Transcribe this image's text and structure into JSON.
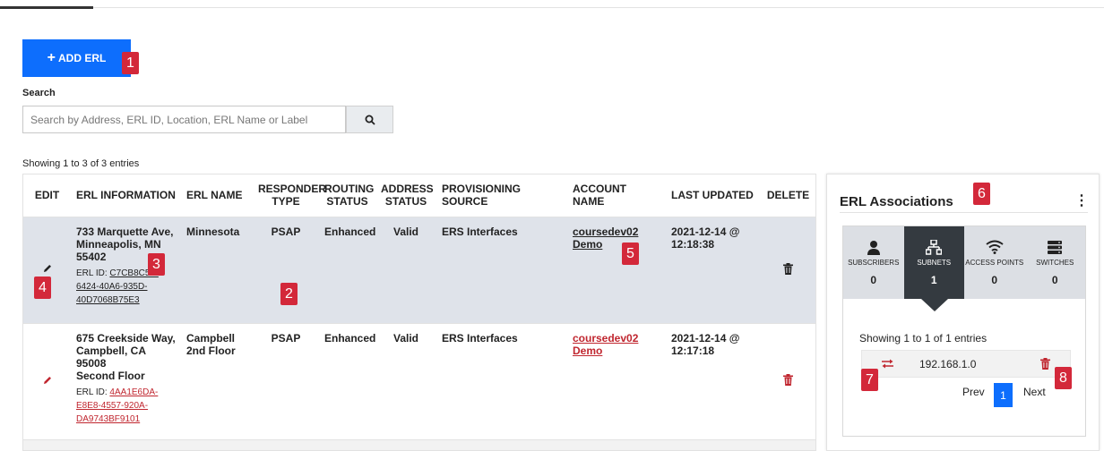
{
  "toolbar": {
    "add_label": "ADD ERL"
  },
  "markers": [
    "1",
    "2",
    "3",
    "4",
    "5",
    "6",
    "7",
    "8"
  ],
  "search": {
    "label": "Search",
    "placeholder": "Search by Address, ERL ID, Location, ERL Name or Label"
  },
  "table": {
    "showing": "Showing 1 to 3 of 3 entries",
    "headers": [
      "EDIT",
      "ERL INFORMATION",
      "ERL NAME",
      "RESPONDER TYPE",
      "ROUTING STATUS",
      "ADDRESS STATUS",
      "PROVISIONING SOURCE",
      "ACCOUNT NAME",
      "LAST UPDATED",
      "DELETE"
    ],
    "rows": [
      {
        "address": "733 Marquette Ave, Minneapolis, MN 55402",
        "location": "",
        "erl_id_label": "ERL ID:",
        "erl_id": "C7CB8C5F-6424-40A6-935D-40D7068B75E3",
        "erl_name": "Minnesota",
        "responder_type": "PSAP",
        "routing_status": "Enhanced",
        "address_status": "Valid",
        "provisioning_source": "ERS Interfaces",
        "account_name": "coursedev02 Demo",
        "last_updated": "2021-12-14 @ 12:18:38"
      },
      {
        "address": "675 Creekside Way, Campbell, CA 95008",
        "location": "Second Floor",
        "erl_id_label": "ERL ID:",
        "erl_id": "4AA1E6DA-E8E8-4557-920A-DA9743BF9101",
        "erl_name": "Campbell 2nd Floor",
        "responder_type": "PSAP",
        "routing_status": "Enhanced",
        "address_status": "Valid",
        "provisioning_source": "ERS Interfaces",
        "account_name": "coursedev02 Demo",
        "last_updated": "2021-12-14 @ 12:17:18"
      }
    ]
  },
  "panel": {
    "title": "ERL Associations",
    "tabs": [
      {
        "label": "SUBSCRIBERS",
        "count": "0",
        "icon": "person-icon"
      },
      {
        "label": "SUBNETS",
        "count": "1",
        "icon": "network-icon"
      },
      {
        "label": "ACCESS POINTS",
        "count": "0",
        "icon": "wifi-icon"
      },
      {
        "label": "SWITCHES",
        "count": "0",
        "icon": "server-icon"
      }
    ],
    "showing": "Showing 1 to 1 of 1 entries",
    "subnet": "192.168.1.0",
    "pager": {
      "prev": "Prev",
      "page": "1",
      "next": "Next"
    }
  },
  "colors": {
    "primary": "#0d6efd",
    "marker": "#d3283a",
    "selected_row": "#dfe3ea",
    "link_red": "#c0262f"
  }
}
